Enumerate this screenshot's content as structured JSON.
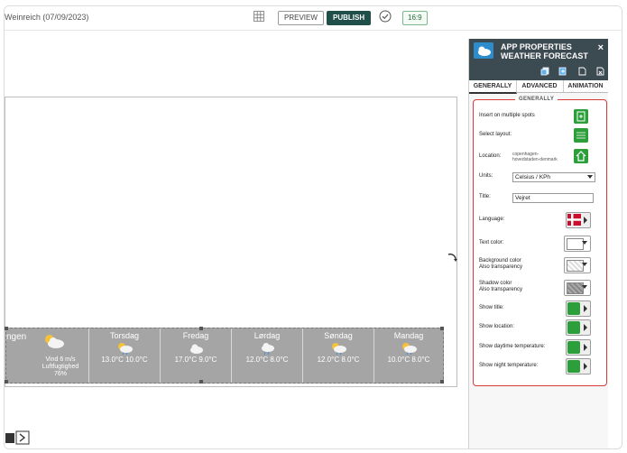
{
  "topbar": {
    "doc_title": "Weinreich (07/09/2023)",
    "preview_label": "PREVIEW",
    "publish_label": "PUBLISH",
    "ratio_label": "16:9",
    "colors": {
      "publish_bg": "#1f4f48",
      "ratio_border": "#7fb78e"
    }
  },
  "canvas": {
    "today": {
      "city": "ngen",
      "wind": "Vind 6 m/s",
      "humidity_label": "Luftfugtighed",
      "humidity_value": "76%"
    },
    "days": [
      {
        "day": "Torsdag",
        "temps": "13.0°C  10.0°C",
        "icon": "sun-cloud-rain-icon"
      },
      {
        "day": "Fredag",
        "temps": "17.0°C  9.0°C",
        "icon": "cloud-icon"
      },
      {
        "day": "Lørdag",
        "temps": "12.0°C  8.0°C",
        "icon": "cloud-rain-icon"
      },
      {
        "day": "Søndag",
        "temps": "12.0°C  8.0°C",
        "icon": "sun-cloud-rain-icon"
      },
      {
        "day": "Mandag",
        "temps": "10.0°C  8.0°C",
        "icon": "sun-cloud-rain-icon"
      }
    ]
  },
  "panel": {
    "title_line1": "APP PROPERTIES",
    "title_line2": "WEATHER FORECAST",
    "close": "×",
    "tabs": [
      "GENERALLY",
      "ADVANCED",
      "ANIMATION"
    ],
    "section_title": "GENERALLY",
    "rows": {
      "insert_spots": "Insert on multiple spots",
      "select_layout": "Select layout:",
      "location_label": "Location:",
      "location_value_line1": "copenhagen-",
      "location_value_line2": "hovedstaden-denmark",
      "units_label": "Units:",
      "units_value": "Celsius / KPh",
      "title_label": "Title:",
      "title_value": "Vejret",
      "language_label": "Language:",
      "text_color_label": "Text color:",
      "bg_color_label_1": "Background color",
      "bg_color_label_2": "Also transparency",
      "shadow_color_label_1": "Shadow color",
      "shadow_color_label_2": "Also transparency",
      "show_title": "Show title:",
      "show_location": "Show location:",
      "show_day_temp": "Show daytime temperature:",
      "show_night_temp": "Show night temperature:"
    },
    "colors": {
      "header_bg": "#3c4a52",
      "accent_green": "#2c9f3a",
      "highlight_red": "#d83a3a"
    }
  }
}
